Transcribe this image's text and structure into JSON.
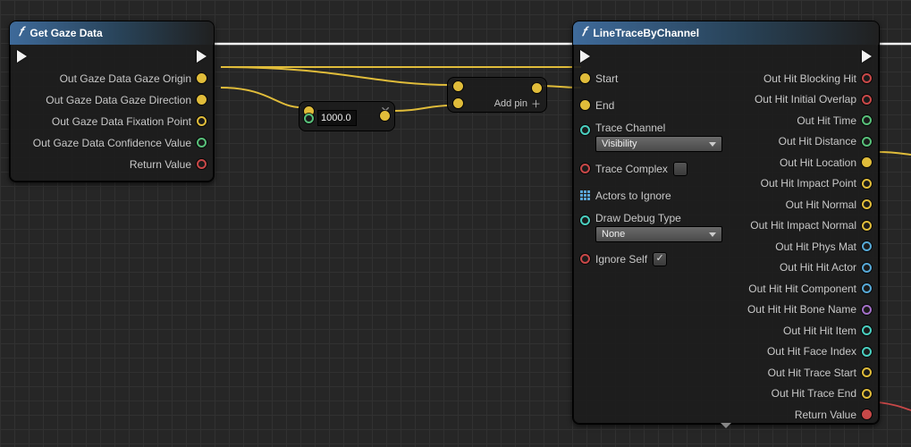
{
  "nodes": {
    "get_gaze": {
      "title": "Get Gaze Data",
      "outputs": [
        "Out Gaze Data Gaze Origin",
        "Out Gaze Data Gaze Direction",
        "Out Gaze Data Fixation Point",
        "Out Gaze Data Confidence Value",
        "Return Value"
      ]
    },
    "multiply": {
      "value": "1000.0"
    },
    "add": {
      "add_pin_label": "Add pin"
    },
    "linetrace": {
      "title": "LineTraceByChannel",
      "inputs": {
        "start": "Start",
        "end": "End",
        "trace_channel": "Trace Channel",
        "trace_complex": "Trace Complex",
        "actors_to_ignore": "Actors to Ignore",
        "draw_debug_type": "Draw Debug Type",
        "ignore_self": "Ignore Self"
      },
      "trace_channel_value": "Visibility",
      "draw_debug_value": "None",
      "ignore_self_checked": true,
      "outputs": [
        "Out Hit Blocking Hit",
        "Out Hit Initial Overlap",
        "Out Hit Time",
        "Out Hit Distance",
        "Out Hit Location",
        "Out Hit Impact Point",
        "Out Hit Normal",
        "Out Hit Impact Normal",
        "Out Hit Phys Mat",
        "Out Hit Hit Actor",
        "Out Hit Hit Component",
        "Out Hit Hit Bone Name",
        "Out Hit Hit Item",
        "Out Hit Face Index",
        "Out Hit Trace Start",
        "Out Hit Trace End",
        "Return Value"
      ]
    }
  },
  "pin_colors": {
    "vector": "#e0bc3a",
    "float": "#58c07a",
    "bool": "#c84848",
    "object": "#56a8d6",
    "name": "#a26fc6",
    "int_enum": "#4acfc0"
  }
}
